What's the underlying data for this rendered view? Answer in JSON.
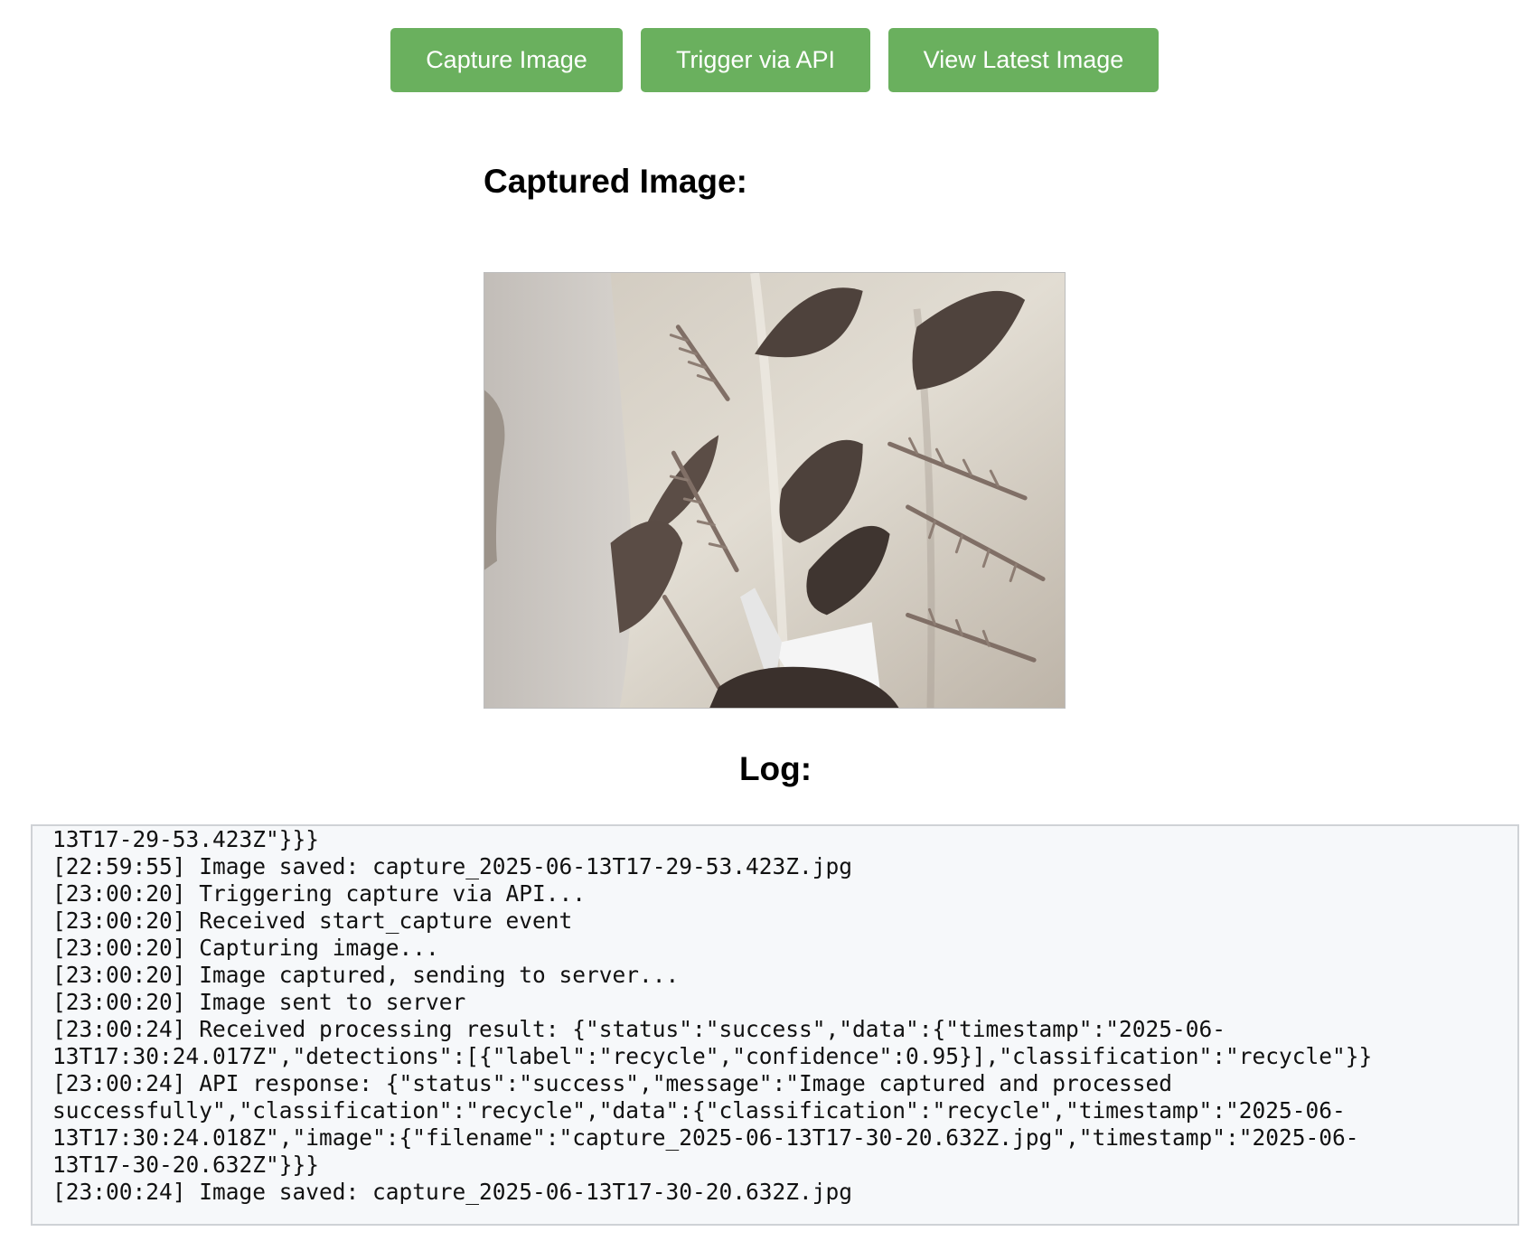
{
  "toolbar": {
    "capture_label": "Capture Image",
    "api_label": "Trigger via API",
    "latest_label": "View Latest Image",
    "button_color": "#6ab05e"
  },
  "captured": {
    "title": "Captured Image:"
  },
  "log": {
    "title": "Log:",
    "lines": [
      "13T17-29-53.423Z\"}}}",
      "[22:59:55] Image saved: capture_2025-06-13T17-29-53.423Z.jpg",
      "[23:00:20] Triggering capture via API...",
      "[23:00:20] Received start_capture event",
      "[23:00:20] Capturing image...",
      "[23:00:20] Image captured, sending to server...",
      "[23:00:20] Image sent to server",
      "[23:00:24] Received processing result: {\"status\":\"success\",\"data\":{\"timestamp\":\"2025-06-",
      "13T17:30:24.017Z\",\"detections\":[{\"label\":\"recycle\",\"confidence\":0.95}],\"classification\":\"recycle\"}}",
      "[23:00:24] API response: {\"status\":\"success\",\"message\":\"Image captured and processed",
      "successfully\",\"classification\":\"recycle\",\"data\":{\"classification\":\"recycle\",\"timestamp\":\"2025-06-",
      "13T17:30:24.018Z\",\"image\":{\"filename\":\"capture_2025-06-13T17-30-20.632Z.jpg\",\"timestamp\":\"2025-06-",
      "13T17-30-20.632Z\"}}}",
      "[23:00:24] Image saved: capture_2025-06-13T17-30-20.632Z.jpg"
    ]
  }
}
